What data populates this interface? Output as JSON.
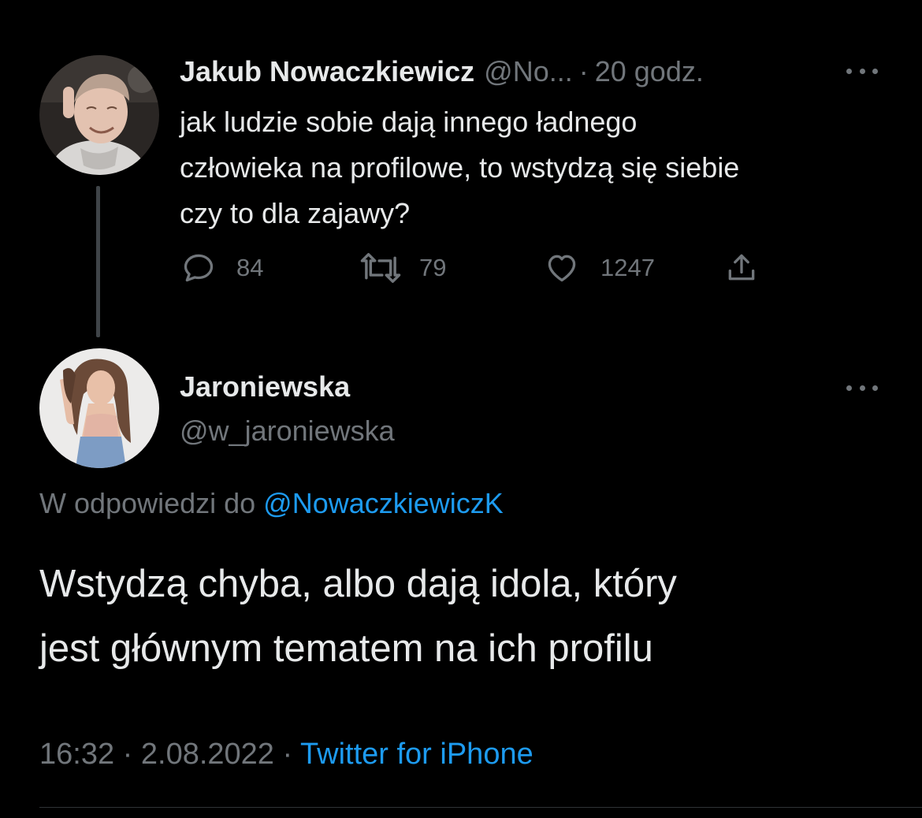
{
  "parent_tweet": {
    "author_name": "Jakub Nowaczkiewicz",
    "author_handle": "@No...",
    "separator": "·",
    "time_ago": "20 godz.",
    "text_lines": [
      "jak ludzie sobie dają innego ładnego",
      "człowieka na profilowe, to wstydzą się siebie",
      "czy to dla zajawy?"
    ],
    "actions": {
      "replies": "84",
      "retweets": "79",
      "likes": "1247"
    },
    "avatar_icon": "profile-photo-man-icon",
    "more_icon": "ellipsis-icon"
  },
  "main_tweet": {
    "author_name": "Jaroniewska",
    "author_handle": "@w_jaroniewska",
    "reply_prefix": "W odpowiedzi do",
    "reply_mention": "@NowaczkiewiczK",
    "text_lines": [
      "Wstydzą chyba, albo dają idola, który",
      "jest głównym tematem na ich profilu"
    ],
    "time": "16:32",
    "separator": "·",
    "date": "2.08.2022",
    "source": "Twitter for iPhone",
    "avatar_icon": "profile-photo-woman-icon",
    "more_icon": "ellipsis-icon"
  },
  "colors": {
    "background": "#000000",
    "primary_text": "#e7e9ea",
    "secondary_text": "#71767b",
    "accent": "#1d9bf0",
    "thread_line": "#3f4448"
  }
}
